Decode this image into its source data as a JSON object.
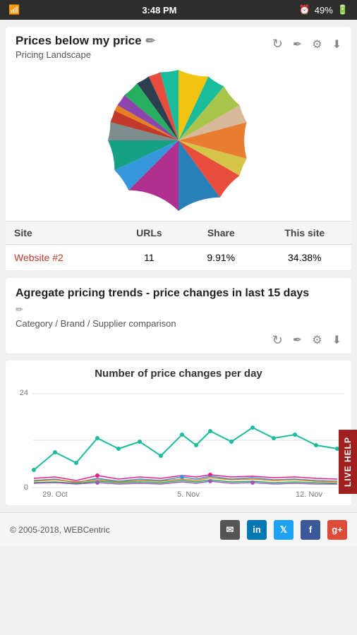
{
  "statusBar": {
    "time": "3:48 PM",
    "battery": "49%"
  },
  "card1": {
    "title": "Prices below my price",
    "subtitle": "Pricing Landscape",
    "tableHeaders": [
      "Site",
      "URLs",
      "Share",
      "This site"
    ],
    "tableRows": [
      {
        "site": "Website #2",
        "urls": "11",
        "share": "9.91%",
        "thisSite": "34.38%"
      }
    ]
  },
  "card2": {
    "title": "Agregate pricing trends - price changes in last 15 days",
    "subtitle": "Category / Brand / Supplier comparison"
  },
  "chart": {
    "title": "Number of price changes per day",
    "yAxisMax": "24",
    "yAxisZero": "0",
    "xLabels": [
      "29. Oct",
      "5. Nov",
      "12. Nov"
    ]
  },
  "footer": {
    "copyright": "© 2005-2018, WEBCentric"
  },
  "liveHelp": {
    "label": "LIVE HELP"
  },
  "pieColors": [
    "#1abc9c",
    "#e74c3c",
    "#3498db",
    "#9b59b6",
    "#e67e22",
    "#2ecc71",
    "#f1c40f",
    "#c0392b",
    "#16a085",
    "#8e44ad",
    "#d35400",
    "#27ae60",
    "#2980b9",
    "#7f8c8d",
    "#bdc3c7",
    "#f39c12",
    "#1abc9c",
    "#e74c3c",
    "#3498db"
  ]
}
